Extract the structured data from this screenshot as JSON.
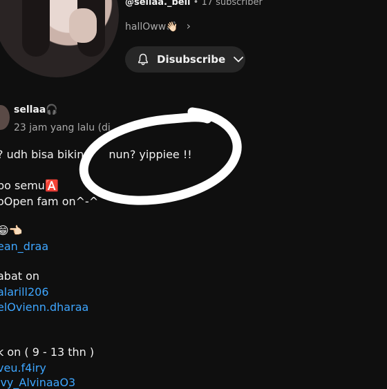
{
  "channel": {
    "handle": "@sellaa._bell",
    "sep": " • ",
    "subscribers": "17 subscriber",
    "description": "hallOww👋🏻",
    "chevron": "›"
  },
  "subscribe_button": {
    "label": "Disubscribe",
    "icon": "bell-icon",
    "dropdown_icon": "chevron-down-icon"
  },
  "comment": {
    "author": "sellaa🎧",
    "time": "23 jam yang lalu (di",
    "lines": [
      {
        "text": "? udh bisa bikin",
        "after": "nun? yippiee !!"
      },
      {
        "text": "po semu🅰️"
      },
      {
        "text": "oOpen fam on^-^"
      },
      {
        "text": "😁👈🏻"
      },
      {
        "link": "ean_draa"
      },
      {
        "text": "abat on"
      },
      {
        "link": "alarill206"
      },
      {
        "link": "elOvienn.dharaa"
      },
      {
        "text": "k on ( 9 - 13 thn )"
      },
      {
        "link": "veu.f4iry"
      },
      {
        "link": "lvy_AlvinaaO3"
      }
    ]
  },
  "annotation": {
    "type": "hand-drawn-circle",
    "color": "#ffffff"
  }
}
